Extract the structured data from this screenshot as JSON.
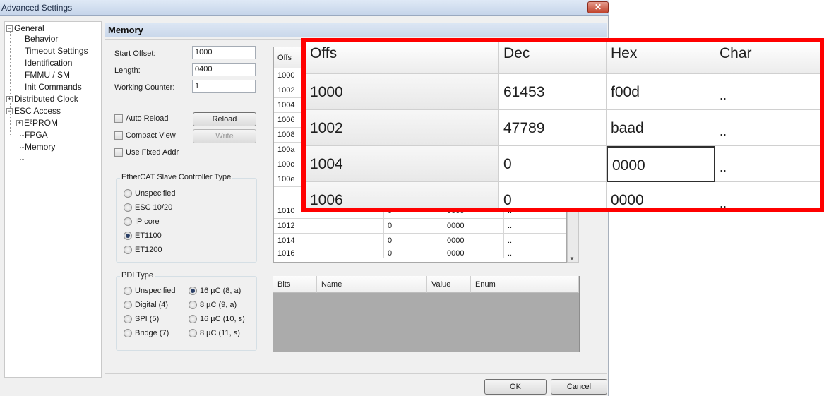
{
  "window": {
    "title": "Advanced Settings",
    "close_label": "✕"
  },
  "tree": {
    "general": "General",
    "behavior": "Behavior",
    "timeout": "Timeout Settings",
    "identification": "Identification",
    "fmmu": "FMMU / SM",
    "init": "Init Commands",
    "dc": "Distributed Clock",
    "esc": "ESC Access",
    "eeprom": "E²PROM",
    "fpga": "FPGA",
    "memory": "Memory",
    "expander_minus": "−",
    "expander_plus": "+"
  },
  "panel": {
    "title": "Memory"
  },
  "form": {
    "start_offset_label": "Start Offset:",
    "start_offset_value": "1000",
    "length_label": "Length:",
    "length_value": "0400",
    "wc_label": "Working Counter:",
    "wc_value": "1",
    "auto_reload": "Auto Reload",
    "reload_btn": "Reload",
    "compact_view": "Compact View",
    "write_btn": "Write",
    "fixed_addr": "Use Fixed Addr"
  },
  "esc_type": {
    "title": "EtherCAT Slave Controller Type",
    "options": [
      "Unspecified",
      "ESC 10/20",
      "IP core",
      "ET1100",
      "ET1200"
    ],
    "selected": "ET1100"
  },
  "pdi_type": {
    "title": "PDI Type",
    "left_options": [
      "Unspecified",
      "Digital (4)",
      "SPI (5)",
      "Bridge (7)"
    ],
    "right_options": [
      "16 µC (8, a)",
      "8 µC (9, a)",
      "16 µC (10, s)",
      "8 µC (11, s)"
    ],
    "selected": "16 µC (8, a)"
  },
  "grid": {
    "header": "Offs",
    "offsets": [
      "1000",
      "1002",
      "1004",
      "1006",
      "1008",
      "100a",
      "100c",
      "100e",
      "1010",
      "1012",
      "1014",
      "1016"
    ],
    "rows_visible": [
      {
        "offs": "1010",
        "dec": "0",
        "hex": "0000",
        "char": ".."
      },
      {
        "offs": "1012",
        "dec": "0",
        "hex": "0000",
        "char": ".."
      },
      {
        "offs": "1014",
        "dec": "0",
        "hex": "0000",
        "char": ".."
      },
      {
        "offs": "1016",
        "dec": "0",
        "hex": "0000",
        "char": ".."
      }
    ]
  },
  "bits_table": {
    "headers": [
      "Bits",
      "Name",
      "Value",
      "Enum"
    ]
  },
  "buttons": {
    "ok": "OK",
    "cancel": "Cancel"
  },
  "zoom": {
    "headers": [
      "Offs",
      "Dec",
      "Hex",
      "Char"
    ],
    "rows": [
      {
        "offs": "1000",
        "dec": "61453",
        "hex": "f00d",
        "char": ".."
      },
      {
        "offs": "1002",
        "dec": "47789",
        "hex": "baad",
        "char": ".."
      },
      {
        "offs": "1004",
        "dec": "0",
        "hex": "0000",
        "char": ".."
      },
      {
        "offs": "1006",
        "dec": "0",
        "hex": "0000",
        "char": ".."
      }
    ],
    "highlight_color": "#ff0000"
  }
}
